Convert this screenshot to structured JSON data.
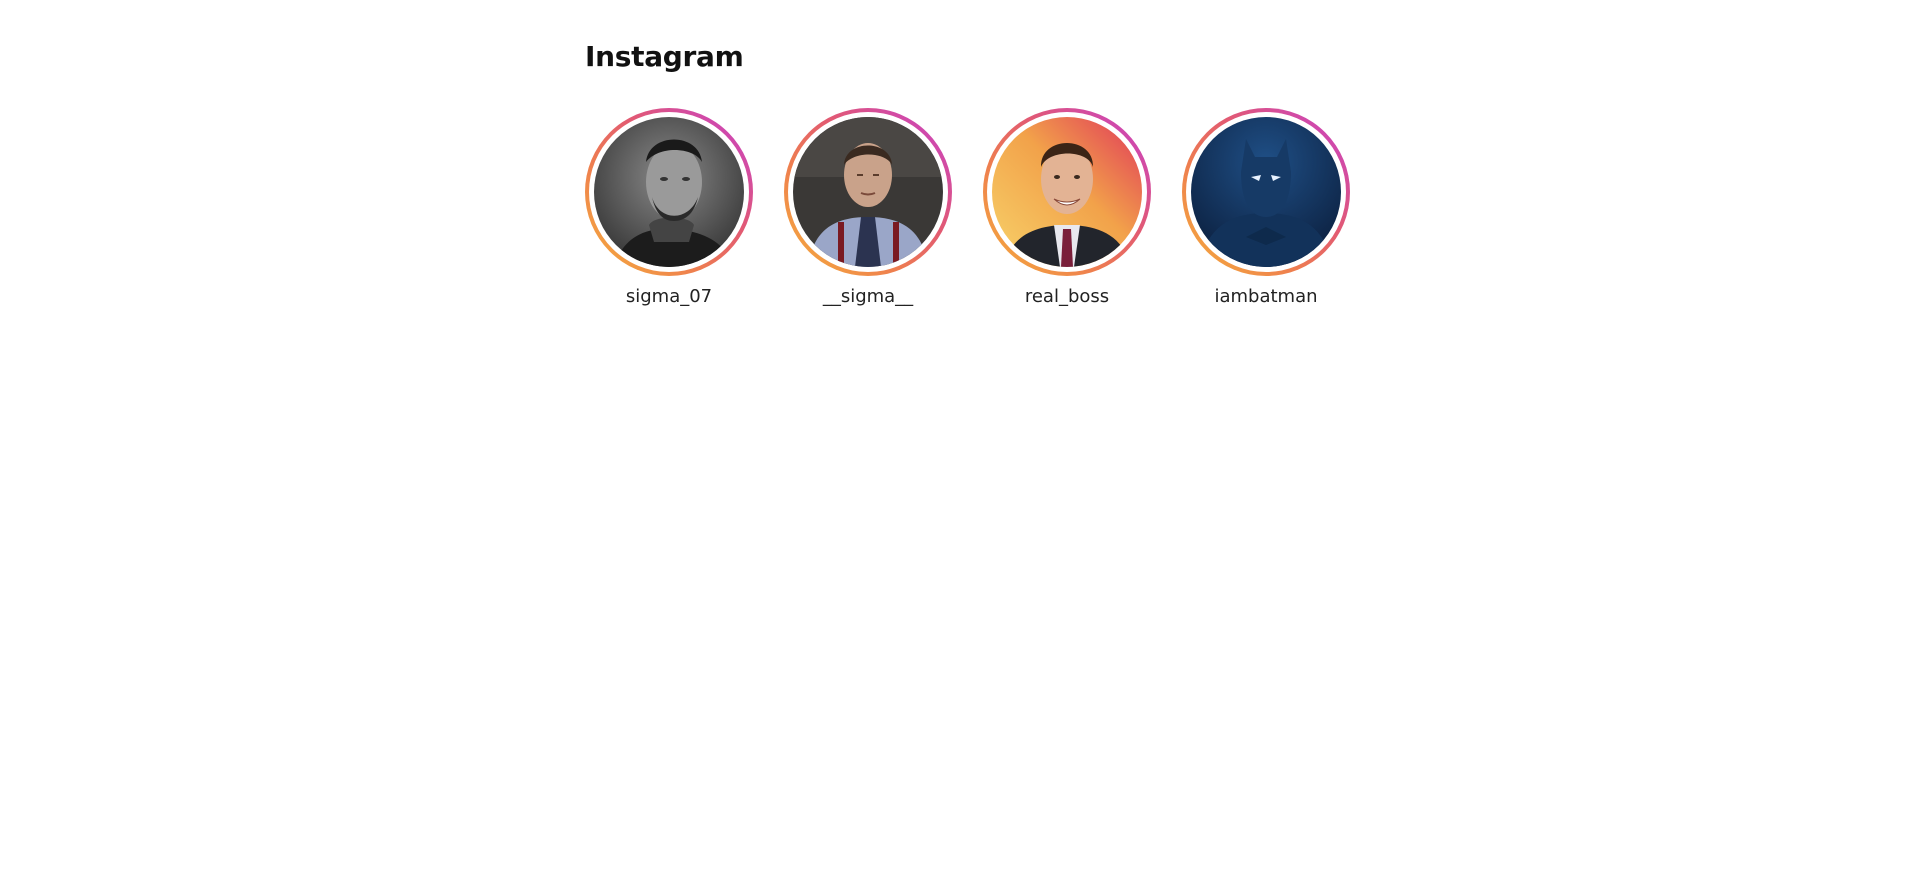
{
  "header": {
    "title": "Instagram"
  },
  "stories": [
    {
      "username": "sigma_07",
      "avatar_icon": "sigma-portrait-bw"
    },
    {
      "username": "__sigma__",
      "avatar_icon": "office-man-portrait"
    },
    {
      "username": "real_boss",
      "avatar_icon": "smiling-suit-portrait"
    },
    {
      "username": "iambatman",
      "avatar_icon": "batman-portrait"
    }
  ],
  "colors": {
    "ring_gradient": [
      "#f6b23a",
      "#ee7e4f",
      "#e25a72",
      "#cc45b8",
      "#c83cc6"
    ],
    "background": "#ffffff",
    "text": "#111111"
  }
}
